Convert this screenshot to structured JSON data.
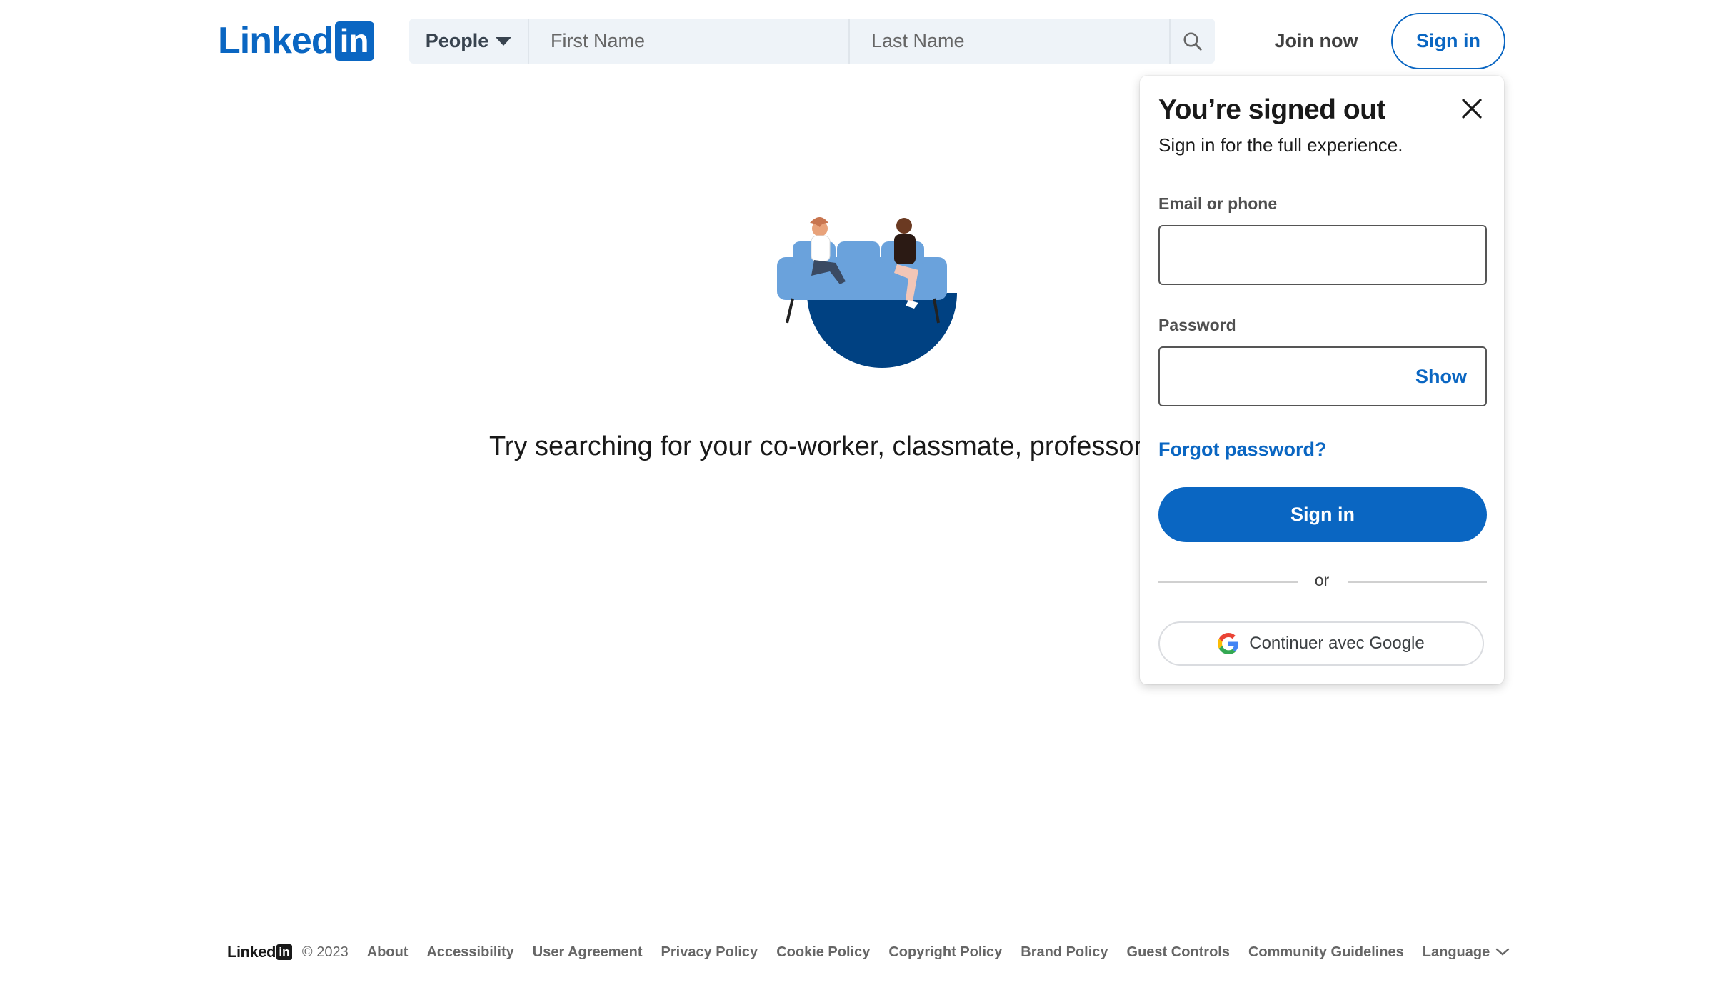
{
  "brand": {
    "logo_text": "Linked",
    "logo_in": "in",
    "color": "#0a66c2"
  },
  "header": {
    "search_type": "People",
    "first_name_placeholder": "First Name",
    "last_name_placeholder": "Last Name",
    "search_icon": "search-icon",
    "join_now": "Join now",
    "sign_in": "Sign in"
  },
  "main": {
    "prompt": "Try searching for your co-worker, classmate, professor, or friend."
  },
  "popup": {
    "title": "You’re signed out",
    "subtitle": "Sign in for the full experience.",
    "email_label": "Email or phone",
    "email_value": "",
    "password_label": "Password",
    "password_value": "",
    "show": "Show",
    "forgot": "Forgot password?",
    "sign_in": "Sign in",
    "or": "or",
    "google": "Continuer avec Google",
    "close_icon": "close-icon"
  },
  "footer": {
    "logo_text": "Linked",
    "logo_in": "in",
    "copyright": "© 2023",
    "links": [
      "About",
      "Accessibility",
      "User Agreement",
      "Privacy Policy",
      "Cookie Policy",
      "Copyright Policy",
      "Brand Policy",
      "Guest Controls",
      "Community Guidelines"
    ],
    "language": "Language"
  },
  "colors": {
    "primary": "#0a66c2",
    "search_bg": "#eef3f8",
    "illustration_dark": "#004182",
    "illustration_sofa": "#6aa2dc"
  }
}
